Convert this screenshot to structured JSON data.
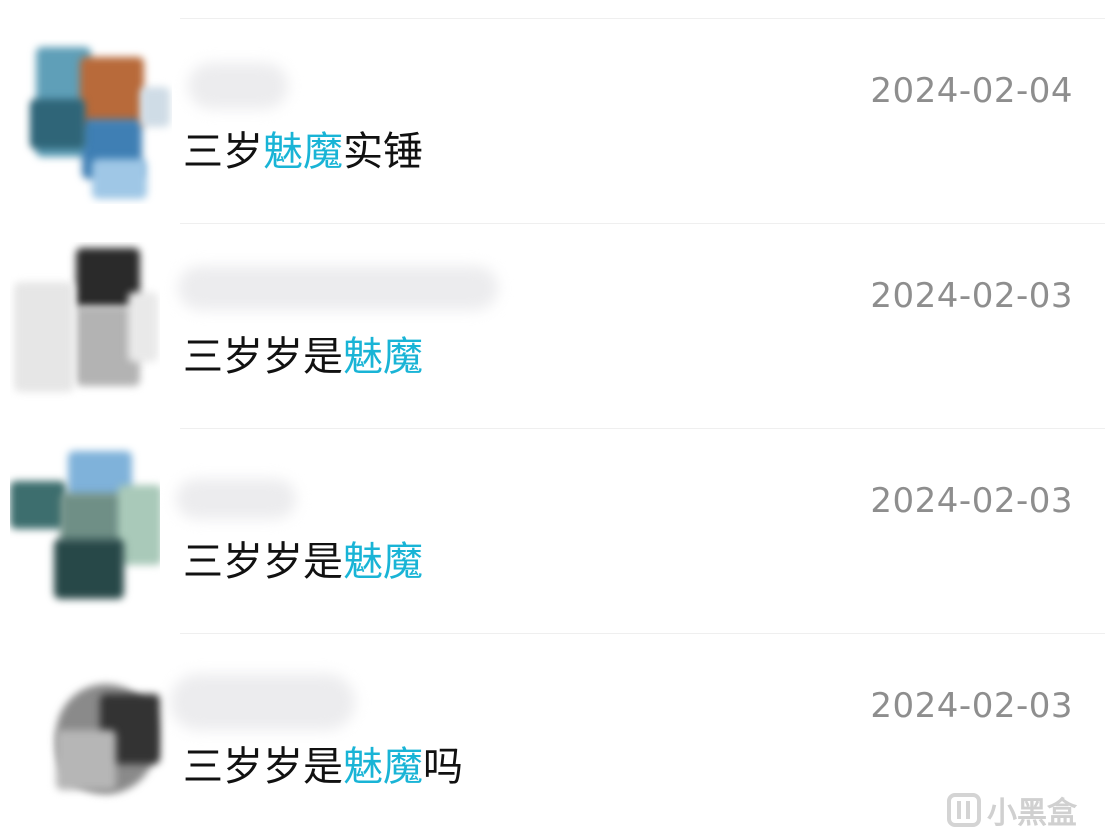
{
  "comments": [
    {
      "date": "2024-02-04",
      "pre": "三岁",
      "highlight": "魅魔",
      "post": "实锤"
    },
    {
      "date": "2024-02-03",
      "pre": "三岁岁是",
      "highlight": "魅魔",
      "post": ""
    },
    {
      "date": "2024-02-03",
      "pre": "三岁岁是",
      "highlight": "魅魔",
      "post": ""
    },
    {
      "date": "2024-02-03",
      "pre": "三岁岁是",
      "highlight": "魅魔",
      "post": "吗"
    }
  ],
  "colors": {
    "highlight": "#19b4d6",
    "date": "#8e8e8e",
    "text": "#111111"
  },
  "watermark": {
    "text": "小黑盒",
    "icon": "heybox-logo-icon"
  }
}
